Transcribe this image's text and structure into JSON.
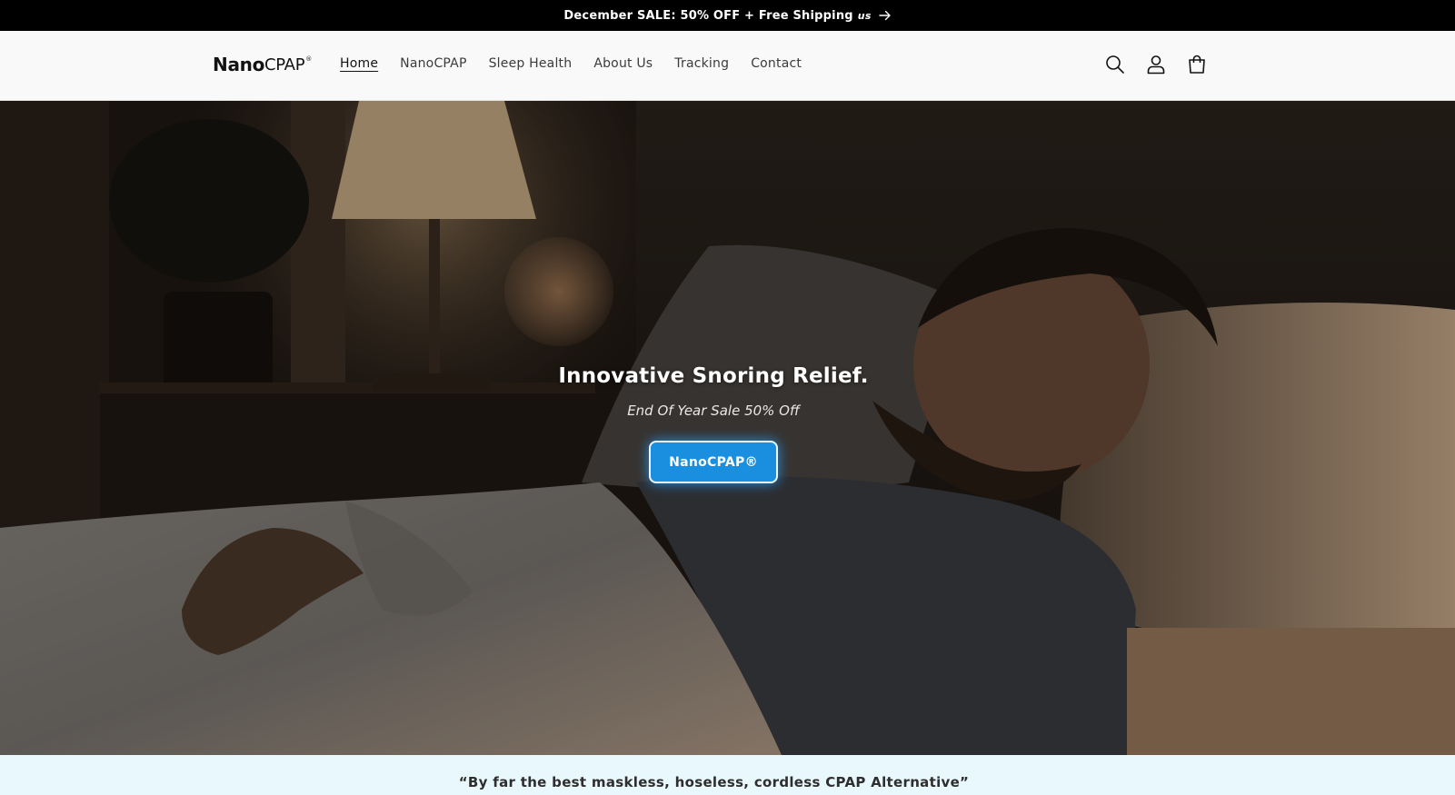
{
  "announcement": {
    "text": "December SALE: 50% OFF + Free Shipping",
    "region": "us",
    "icon": "arrow-right-icon"
  },
  "header": {
    "logo": {
      "strong": "Nano",
      "light": "CPAP",
      "mark": "®"
    },
    "nav": [
      {
        "label": "Home",
        "active": true
      },
      {
        "label": "NanoCPAP",
        "active": false
      },
      {
        "label": "Sleep Health",
        "active": false
      },
      {
        "label": "About Us",
        "active": false
      },
      {
        "label": "Tracking",
        "active": false
      },
      {
        "label": "Contact",
        "active": false
      }
    ],
    "icons": [
      "search-icon",
      "account-icon",
      "cart-icon"
    ]
  },
  "hero": {
    "title": "Innovative Snoring Relief.",
    "subtitle": "End Of Year Sale 50% Off",
    "button_label": "NanoCPAP®",
    "button_color": "#1a8fe0"
  },
  "quote": {
    "text": "“By far the best maskless, hoseless, cordless CPAP Alternative”"
  },
  "colors": {
    "announcement_bg": "#000000",
    "header_bg": "#f9f9f9",
    "quote_bg": "#e9f8fd"
  }
}
